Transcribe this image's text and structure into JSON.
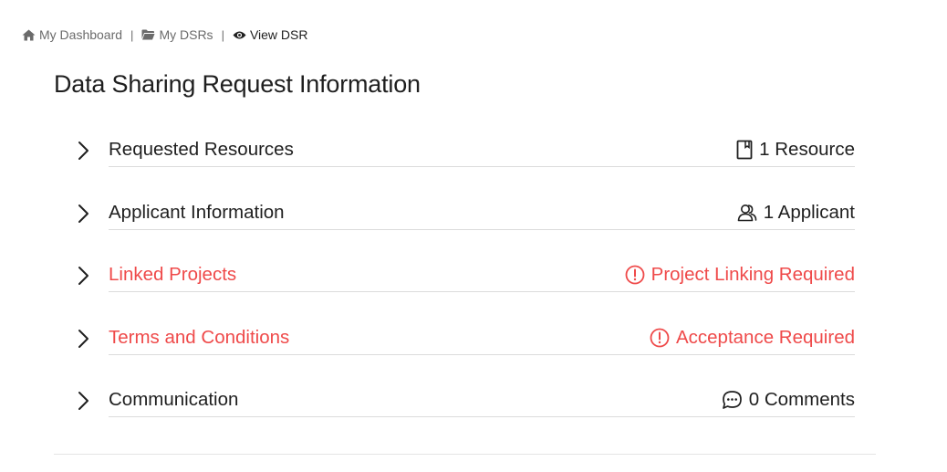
{
  "breadcrumb": {
    "items": [
      {
        "label": "My Dashboard",
        "icon": "home-icon"
      },
      {
        "label": "My DSRs",
        "icon": "folder-icon"
      },
      {
        "label": "View DSR",
        "icon": "eye-icon"
      }
    ],
    "separator": "|"
  },
  "page": {
    "title": "Data Sharing Request Information"
  },
  "sections": [
    {
      "label": "Requested Resources",
      "status": "1 Resource",
      "status_icon": "bookmark-icon",
      "state": "normal"
    },
    {
      "label": "Applicant Information",
      "status": "1 Applicant",
      "status_icon": "users-icon",
      "state": "normal"
    },
    {
      "label": "Linked Projects",
      "status": "Project Linking Required",
      "status_icon": "alert-circle-icon",
      "state": "warning"
    },
    {
      "label": "Terms and Conditions",
      "status": "Acceptance Required",
      "status_icon": "alert-circle-icon",
      "state": "warning"
    },
    {
      "label": "Communication",
      "status": "0 Comments",
      "status_icon": "comment-icon",
      "state": "normal"
    }
  ],
  "colors": {
    "text": "#1f1f1f",
    "muted": "#6b6b6b",
    "warning": "#ef4a4a",
    "divider": "#dcdcdc"
  }
}
